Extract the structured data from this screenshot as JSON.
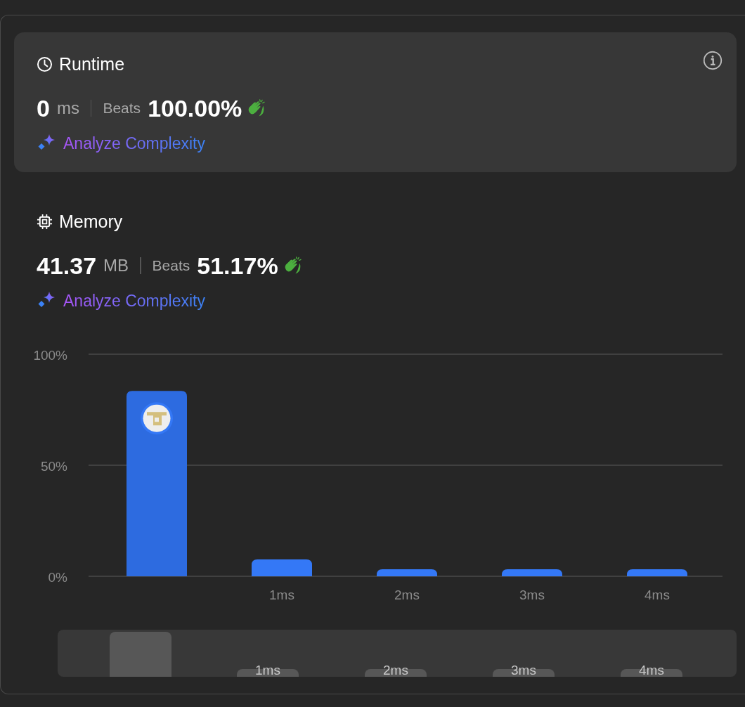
{
  "runtime": {
    "title": "Runtime",
    "value": "0",
    "unit": "ms",
    "beats_label": "Beats",
    "beats": "100.00%",
    "analyze": "Analyze Complexity"
  },
  "memory": {
    "title": "Memory",
    "value": "41.37",
    "unit": "MB",
    "beats_label": "Beats",
    "beats": "51.17%",
    "analyze": "Analyze Complexity"
  },
  "chart": {
    "chart_data": {
      "type": "bar",
      "categories": [
        null,
        "1ms",
        "2ms",
        "3ms",
        "4ms"
      ],
      "values": [
        83.5,
        7.6,
        3.2,
        3.2,
        3.2
      ],
      "ylim": [
        0,
        100
      ],
      "yticks": [
        {
          "value": 0,
          "label": "0%"
        },
        {
          "value": 50,
          "label": "50%"
        },
        {
          "value": 100,
          "label": "100%"
        }
      ]
    },
    "overview": {
      "labels": [
        "1ms",
        "2ms",
        "3ms",
        "4ms"
      ]
    }
  }
}
